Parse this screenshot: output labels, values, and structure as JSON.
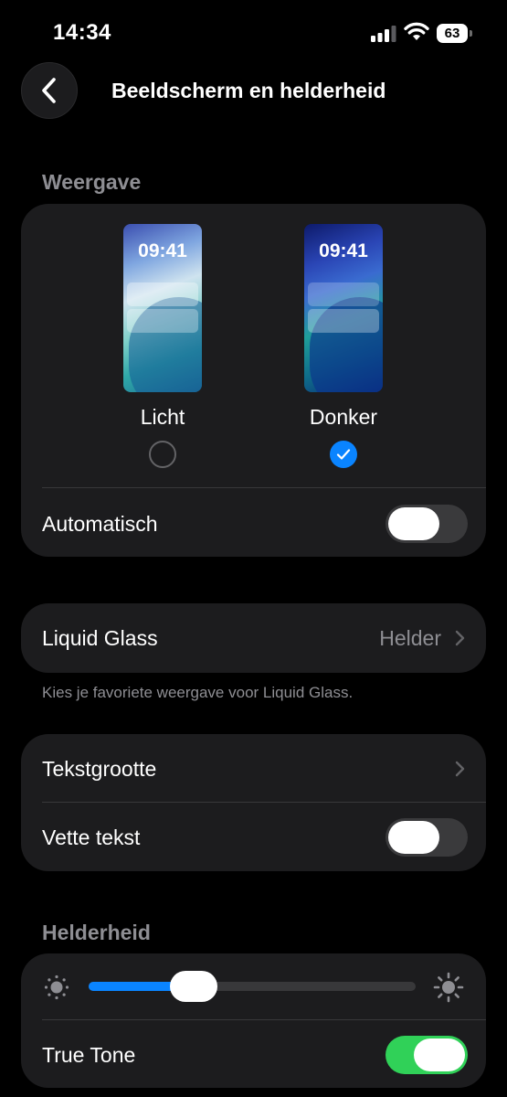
{
  "status": {
    "time": "14:34",
    "battery": "63"
  },
  "nav": {
    "title": "Beeldscherm en helderheid"
  },
  "appearance": {
    "section_label": "Weergave",
    "light": {
      "label": "Licht",
      "preview_time": "09:41",
      "selected": false
    },
    "dark": {
      "label": "Donker",
      "preview_time": "09:41",
      "selected": true
    },
    "automatic": {
      "label": "Automatisch",
      "on": false
    }
  },
  "liquid_glass": {
    "label": "Liquid Glass",
    "value": "Helder",
    "footer": "Kies je favoriete weergave voor Liquid Glass."
  },
  "text": {
    "text_size_label": "Tekstgrootte",
    "bold_text": {
      "label": "Vette tekst",
      "on": false
    }
  },
  "brightness": {
    "section_label": "Helderheid",
    "level": 0.32,
    "true_tone": {
      "label": "True Tone",
      "on": true
    }
  },
  "colors": {
    "accent": "#0a84ff",
    "toggle_on": "#30d158",
    "card": "#1c1c1e"
  }
}
